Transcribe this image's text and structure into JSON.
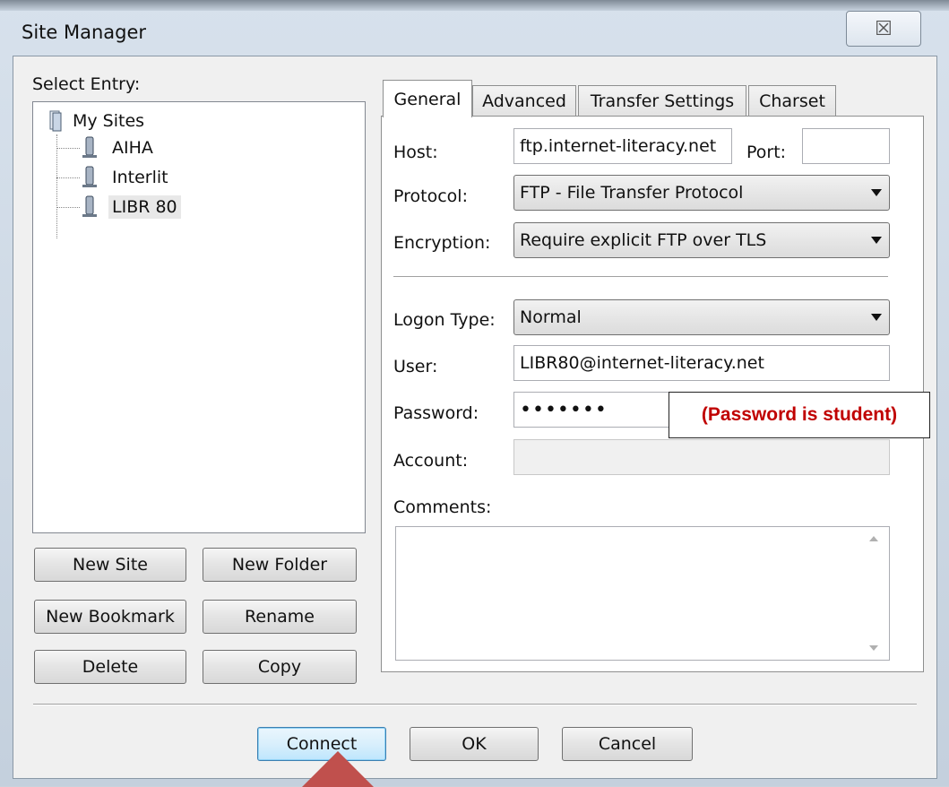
{
  "window": {
    "title": "Site Manager",
    "close_glyph": "☒"
  },
  "tree": {
    "label": "Select Entry:",
    "root": "My Sites",
    "items": [
      "AIHA",
      "Interlit",
      "LIBR 80"
    ],
    "selected": "LIBR 80"
  },
  "left_buttons": {
    "new_site": "New Site",
    "new_folder": "New Folder",
    "new_bookmark": "New Bookmark",
    "rename": "Rename",
    "delete": "Delete",
    "copy": "Copy"
  },
  "tabs": [
    "General",
    "Advanced",
    "Transfer Settings",
    "Charset"
  ],
  "general": {
    "host_label": "Host:",
    "host_value": "ftp.internet-literacy.net",
    "port_label": "Port:",
    "port_value": "",
    "protocol_label": "Protocol:",
    "protocol_value": "FTP - File Transfer Protocol",
    "encryption_label": "Encryption:",
    "encryption_value": "Require explicit FTP over TLS",
    "logon_label": "Logon Type:",
    "logon_value": "Normal",
    "user_label": "User:",
    "user_value": "LIBR80@internet-literacy.net",
    "password_label": "Password:",
    "password_value": "•••••••",
    "account_label": "Account:",
    "account_value": "",
    "comments_label": "Comments:"
  },
  "annotation": {
    "text": "(Password is student)",
    "color": "#c00000"
  },
  "bottom_buttons": {
    "connect": "Connect",
    "ok": "OK",
    "cancel": "Cancel"
  },
  "colors": {
    "pointer": "#c0504d",
    "default_button_border": "#3c7fb1"
  }
}
